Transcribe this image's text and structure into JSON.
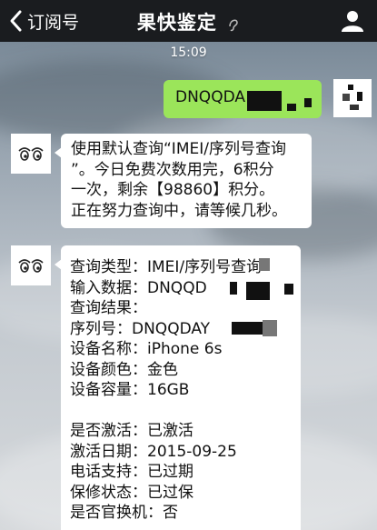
{
  "header": {
    "back_label": "订阅号",
    "title": "果快鉴定"
  },
  "chat": {
    "timestamp": "15:09",
    "outgoing": {
      "text": "DNQQDA"
    },
    "incoming_1": {
      "lines": [
        "使用默认查询“IMEI/序列号查询",
        "”。今日免费次数用完，6积分",
        "一次，剩余【98860】积分。",
        "正在努力查询中，请等候几秒。"
      ]
    },
    "incoming_2": {
      "query_type": "查询类型：IMEI/序列号查询",
      "input_data": "输入数据：DNQQD",
      "result_label": "查询结果：",
      "serial": "序列号：DNQQDAY",
      "device_name": "设备名称：iPhone 6s",
      "device_color": "设备颜色：金色",
      "device_capacity": "设备容量：16GB",
      "activated": "是否激活：已激活",
      "activation_date": "激活日期：2015-09-25",
      "phone_support": "电话支持：已过期",
      "warranty_status": "保修状态：已过保",
      "official_replacement": "是否官换机：否"
    }
  }
}
